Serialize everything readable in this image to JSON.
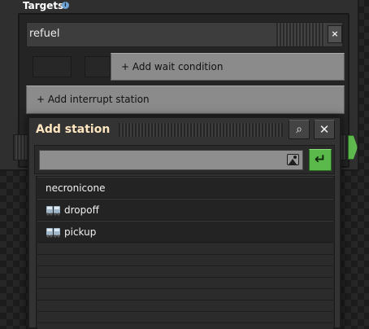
{
  "targets": {
    "title": "Targets",
    "info_icon": "info-icon",
    "schedule": {
      "station_name": "refuel",
      "close_symbol": "×",
      "wait_condition_label": "+ Add wait condition"
    },
    "add_interrupt_label": "+ Add interrupt station"
  },
  "dialog": {
    "title": "Add station",
    "search_icon": "⌕",
    "close_icon": "✕",
    "search": {
      "value": "",
      "placeholder": ""
    },
    "image_icon": "image-icon",
    "confirm_icon": "↵",
    "stations": [
      {
        "label": "necronicone",
        "icon": null
      },
      {
        "label": "dropoff",
        "icon": "train-station-icon"
      },
      {
        "label": "pickup",
        "icon": "train-station-icon"
      }
    ]
  },
  "colors": {
    "confirm_green": "#5bb94b",
    "dialog_title": "#ffe6c0",
    "button_gray": "#8b8b8b",
    "info_blue": "#6fa3d6"
  }
}
